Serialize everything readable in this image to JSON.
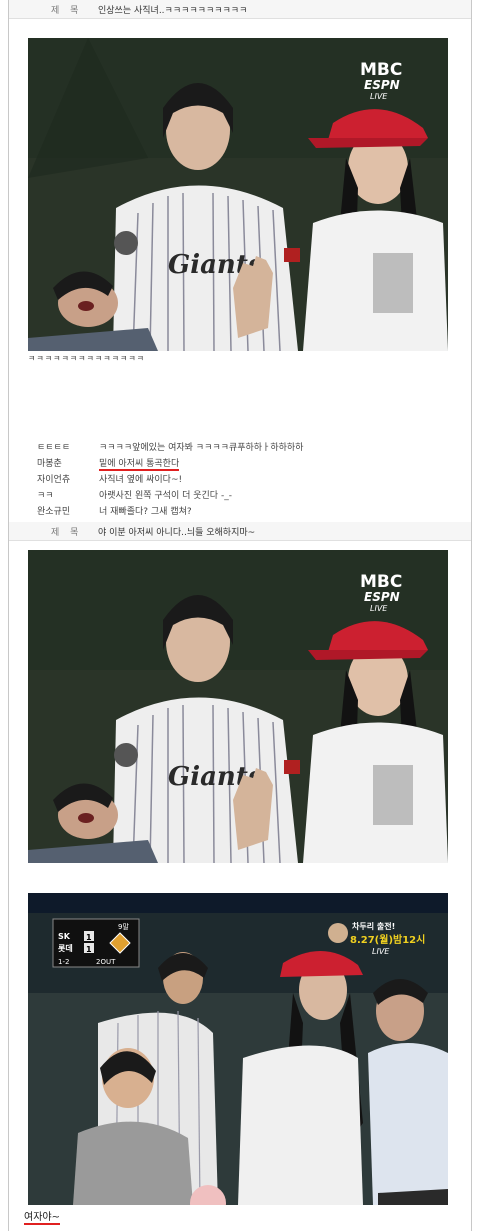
{
  "post": {
    "title_label": "제 목",
    "title": "인상쓰는 사직녀..ㅋㅋㅋㅋㅋㅋㅋㅋㅋㅋ",
    "caption": "ㅋㅋㅋㅋㅋㅋㅋㅋㅋㅋㅋㅋㅋㅋ"
  },
  "broadcast": {
    "logo_top": "MBC",
    "logo_bottom": "ESPN",
    "live": "LIVE",
    "jersey_text": "Giants"
  },
  "comments": [
    {
      "nick": "ㅌㅌㅌㅌ",
      "text": "ㅋㅋㅋㅋ앞에있는 여자봐 ㅋㅋㅋㅋ큐푸하하ㅏ하하하하",
      "highlight": false
    },
    {
      "nick": "마봉춘",
      "text": "밑에 아저씨 통곡한다",
      "highlight": true
    },
    {
      "nick": "자이언츄",
      "text": "사직녀 옆에 싸이다~!",
      "highlight": false
    },
    {
      "nick": "ㅋㅋ",
      "text": "아랫사진 왼쪽 구석이 더 웃긴다 -_-",
      "highlight": false
    },
    {
      "nick": "완소규민",
      "text": "너 재빠졸다? 그새 캡쳐?",
      "highlight": false
    }
  ],
  "reply": {
    "title_label": "제 목",
    "title": "야 이분 아저씨 아니다..늬들 오해하지마~"
  },
  "scoreboard": {
    "inning": "9말",
    "team1": "SK",
    "score1": "1",
    "team2": "롯데",
    "score2": "1",
    "count": "1-2",
    "outs": "2OUT",
    "promo_title": "차두리 출전!",
    "promo_date": "8.27(월)밤12시",
    "promo_live": "LIVE"
  },
  "bottom_text": "여자야~"
}
